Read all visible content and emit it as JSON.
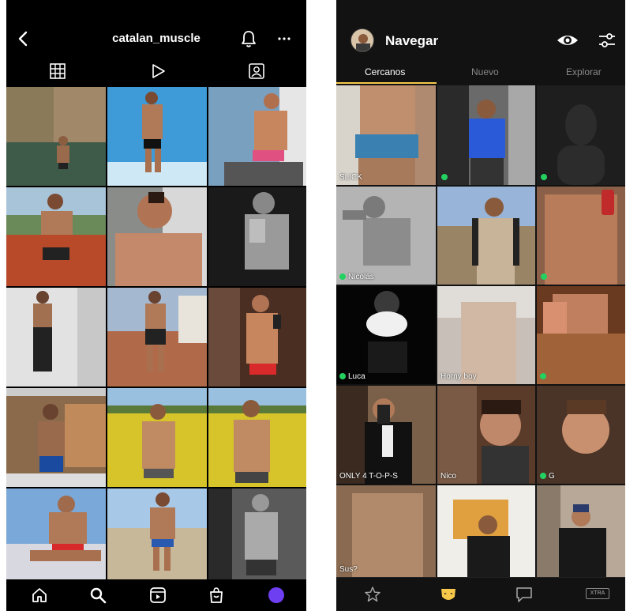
{
  "instagram": {
    "username": "catalan_muscle",
    "tabs": [
      "grid-icon",
      "reels-icon",
      "tagged-icon"
    ],
    "bottom_nav": [
      "home-icon",
      "search-icon",
      "reels-icon",
      "shop-icon",
      "profile-icon"
    ]
  },
  "grindr": {
    "title": "Navegar",
    "tabs": [
      {
        "label": "Cercanos",
        "active": true
      },
      {
        "label": "Nuevo",
        "active": false
      },
      {
        "label": "Explorar",
        "active": false
      }
    ],
    "cells": [
      {
        "label": "SLICK",
        "online": false
      },
      {
        "label": "",
        "online": true
      },
      {
        "label": "",
        "online": true
      },
      {
        "label": "Nicolás",
        "online": true
      },
      {
        "label": "",
        "online": false
      },
      {
        "label": "",
        "online": true
      },
      {
        "label": "Luca",
        "online": true
      },
      {
        "label": "Horny boy",
        "online": false
      },
      {
        "label": "",
        "online": true
      },
      {
        "label": "ONLY 4 T-O-P-S",
        "online": false
      },
      {
        "label": "Nico",
        "online": false
      },
      {
        "label": "G",
        "online": true
      },
      {
        "label": "Sus?",
        "online": false
      },
      {
        "label": "",
        "online": false
      },
      {
        "label": "",
        "online": false
      }
    ],
    "bottom_nav": [
      "star-icon",
      "grindr-mask-icon",
      "chat-icon"
    ],
    "xtra_label": "XTRA"
  }
}
